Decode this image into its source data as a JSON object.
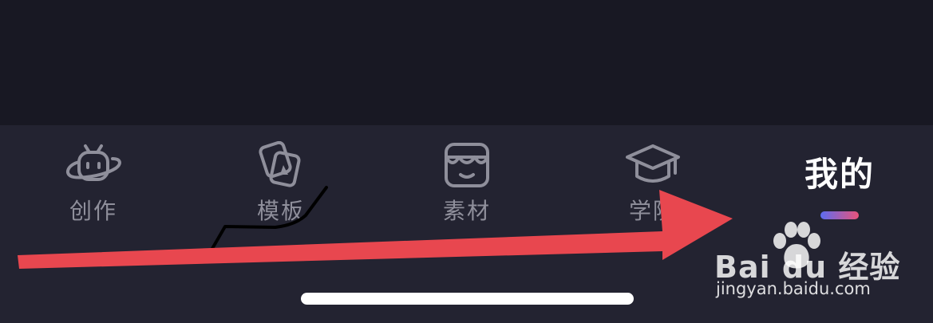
{
  "tabs": {
    "create": {
      "label": "创作",
      "icon": "tv-robot-icon"
    },
    "template": {
      "label": "模板",
      "icon": "cards-icon"
    },
    "material": {
      "label": "素材",
      "icon": "store-icon"
    },
    "school": {
      "label": "学院",
      "icon": "graduation-cap-icon"
    },
    "mine": {
      "label": "我的",
      "active": true
    }
  },
  "watermark": {
    "brand": "Bai du 经验",
    "url": "jingyan.baidu.com"
  },
  "colors": {
    "background_top": "#181823",
    "tab_bar": "#232331",
    "tab_label": "#8f8f9b",
    "active_label": "#ffffff",
    "indicator_start": "#5c6cf0",
    "indicator_end": "#e9537a",
    "annotation_arrow": "#e8474f",
    "annotation_stroke": "#000000"
  }
}
